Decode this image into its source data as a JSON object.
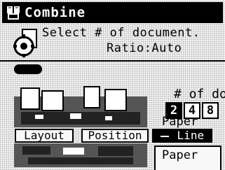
{
  "window": {
    "title": "Combine",
    "title_icon": "combine-pages-icon"
  },
  "message": {
    "icon": "document-gear-icon",
    "line1": "Select # of document.",
    "line2": "Ratio:Auto"
  },
  "number_of_docs": {
    "label": "# of doc",
    "options": [
      "2",
      "4",
      "8"
    ],
    "selected": "2"
  },
  "paper_label": "Paper",
  "tabs": [
    {
      "label": "Layout",
      "active": false
    },
    {
      "label": "Position",
      "active": false
    },
    {
      "label": "Line",
      "active": true,
      "icon": "line-icon"
    }
  ],
  "paper_button_label": "Paper",
  "colors": {
    "titlebar_bg": "#000000",
    "titlebar_fg": "#ffffff",
    "selected_bg": "#000000",
    "selected_fg": "#ffffff"
  }
}
